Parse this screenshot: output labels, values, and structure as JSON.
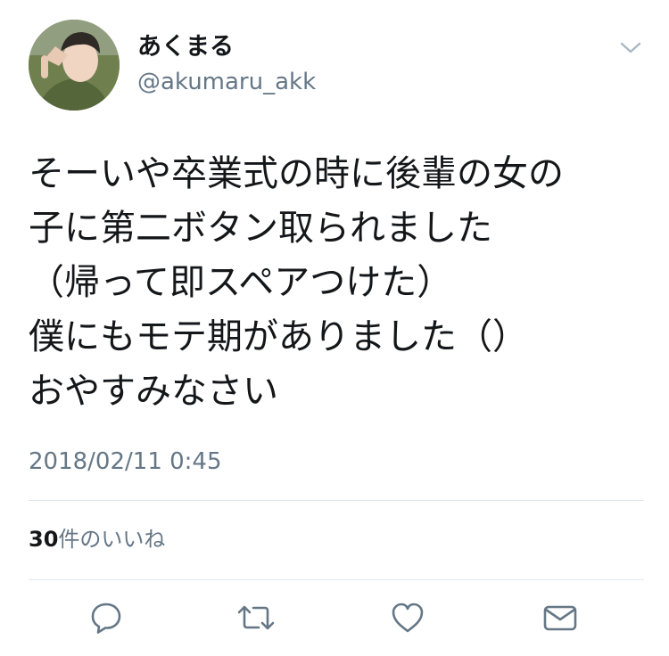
{
  "user": {
    "display_name": "あくまる",
    "handle": "@akumaru_akk"
  },
  "tweet": {
    "lines": [
      "そーいや卒業式の時に後輩の女の",
      "子に第二ボタン取られました",
      "（帰って即スペアつけた）",
      "僕にもモテ期がありました（）",
      "おやすみなさい"
    ],
    "timestamp": "2018/02/11 0:45"
  },
  "stats": {
    "likes_count": "30",
    "likes_label": "件のいいね"
  },
  "icons": {
    "menu": "chevron-down-icon",
    "reply": "reply-icon",
    "retweet": "retweet-icon",
    "like": "heart-icon",
    "dm": "envelope-icon"
  },
  "colors": {
    "text": "#14171a",
    "secondary": "#657786",
    "icon": "#657786",
    "divider": "#e1e8ed"
  }
}
